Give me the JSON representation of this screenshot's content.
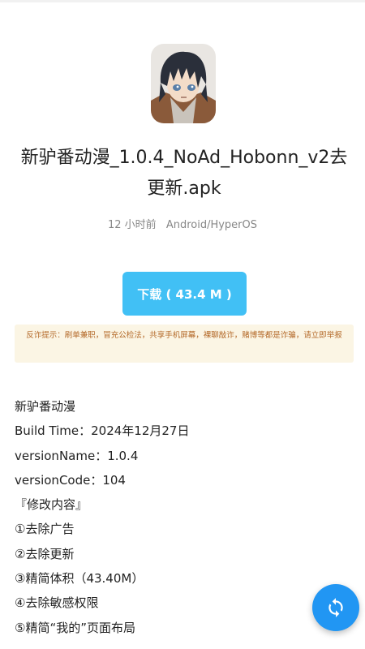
{
  "app": {
    "title": "新驴番动漫_1.0.4_NoAd_Hobonn_v2去更新.apk",
    "time_ago": "12 小时前",
    "platform": "Android/HyperOS"
  },
  "download": {
    "label": "下载 ( 43.4 M )"
  },
  "warning": {
    "text": "反诈提示：刷单兼职，冒充公检法，共享手机屏幕，裸聊敲诈，赌博等都是诈骗，请立即举报"
  },
  "description": {
    "lines": [
      "新驴番动漫",
      "Build Time：2024年12月27日",
      "versionName：1.0.4",
      "versionCode：104",
      "『修改内容』",
      "①去除广告",
      "②去除更新",
      "③精简体积（43.40M）",
      "④去除敏感权限",
      "⑤精简“我的”页面布局"
    ]
  },
  "icons": {
    "app_icon": "anime-character-app-icon",
    "fab_icon": "refresh-icon"
  },
  "colors": {
    "download_button": "#41c0f5",
    "warning_bg": "#fbf5e4",
    "warning_text": "#b46a2a",
    "fab": "#2196f3"
  }
}
